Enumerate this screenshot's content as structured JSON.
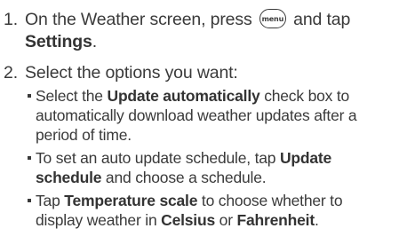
{
  "steps": [
    {
      "number": "1.",
      "line1_pre": "On the Weather screen, press",
      "key_label": "menu",
      "line1_post": "and tap",
      "line2_bold": "Settings",
      "line2_end": "."
    },
    {
      "number": "2.",
      "text": "Select the options you want:"
    }
  ],
  "bullets": [
    {
      "pre": "Select the ",
      "bold": "Update automatically",
      "post": " check box to",
      "line2": "automatically download weather updates after a",
      "line3": "period of time."
    },
    {
      "pre": "To set an auto update schedule, tap ",
      "bold1": "Update",
      "bold2": "schedule",
      "post": " and choose a schedule."
    },
    {
      "pre": "Tap ",
      "bold1": "Temperature scale",
      "post1": " to choose whether to",
      "pre2": "display weather in ",
      "bold2": "Celsius",
      "mid2": " or ",
      "bold3": "Fahrenheit",
      "end2": "."
    }
  ]
}
